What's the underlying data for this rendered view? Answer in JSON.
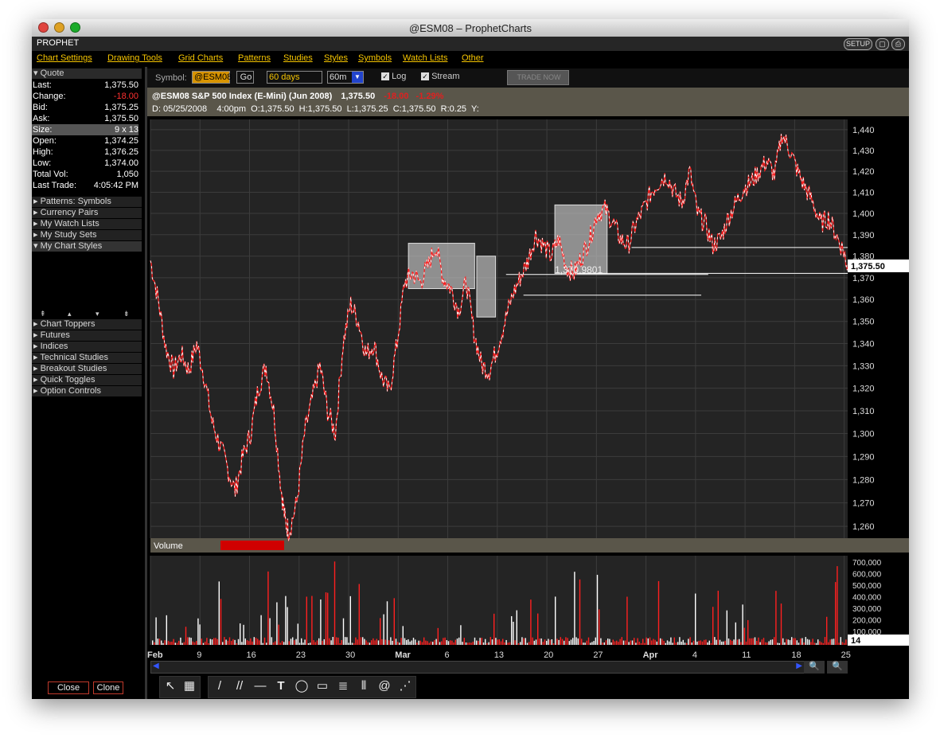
{
  "window": {
    "title": "@ESM08 – ProphetCharts"
  },
  "brand": {
    "name": "PROPHET",
    "setup": "SETUP"
  },
  "menu": [
    "Chart Settings",
    "Drawing Tools",
    "Grid Charts",
    "Patterns",
    "Studies",
    "Styles",
    "Symbols",
    "Watch Lists",
    "Other"
  ],
  "quote": {
    "header": "Quote",
    "rows": [
      {
        "label": "Last:",
        "value": "1,375.50"
      },
      {
        "label": "Change:",
        "value": "-18.00"
      },
      {
        "label": "Bid:",
        "value": "1,375.25"
      },
      {
        "label": "Ask:",
        "value": "1,375.50"
      },
      {
        "label": "Size:",
        "value": "9 x 13"
      },
      {
        "label": "Open:",
        "value": "1,374.25"
      },
      {
        "label": "High:",
        "value": "1,376.25"
      },
      {
        "label": "Low:",
        "value": "1,374.00"
      },
      {
        "label": "Total Vol:",
        "value": "1,050"
      },
      {
        "label": "Last Trade:",
        "value": "4:05:42 PM"
      }
    ]
  },
  "sidebar_sections_top": [
    "Patterns: Symbols",
    "Currency Pairs",
    "My Watch Lists",
    "My Study Sets",
    "My Chart Styles"
  ],
  "sidebar_sections_bottom": [
    "Chart Toppers",
    "Futures",
    "Indices",
    "Technical Studies",
    "Breakout Studies",
    "Quick Toggles",
    "Option Controls"
  ],
  "sidebar_buttons": {
    "close": "Close",
    "clone": "Clone"
  },
  "toolbar": {
    "symbol_label": "Symbol:",
    "symbol_value": "@ESM08",
    "go": "Go",
    "range": "60 days",
    "interval": "60m",
    "log_label": "Log",
    "stream_label": "Stream",
    "trade_now": "TRADE NOW"
  },
  "info": {
    "line1_symbol": "@ESM08 S&P 500 Index (E-Mini) (Jun 2008)",
    "line1_price": "1,375.50",
    "line1_change": "-18.00",
    "line1_pct": "-1.29%",
    "line2": "D: 05/25/2008    4:00pm  O:1,375.50  H:1,375.50  L:1,375.25  C:1,375.50  R:0.25  Y:"
  },
  "chart_data": {
    "type": "candlestick-line",
    "price_axis": {
      "ticks": [
        "1,440",
        "1,430",
        "1,420",
        "1,410",
        "1,400",
        "1,390",
        "1,380",
        "1,370",
        "1,360",
        "1,350",
        "1,340",
        "1,330",
        "1,320",
        "1,310",
        "1,300",
        "1,290",
        "1,280",
        "1,270",
        "1,260"
      ],
      "ylim": [
        1255,
        1445
      ],
      "scale": "log"
    },
    "last_price_label": "1,375.50",
    "annotation": "1,370.9801",
    "volume_label": "Volume",
    "volume_axis": {
      "ticks": [
        "700,000",
        "600,000",
        "500,000",
        "400,000",
        "300,000",
        "200,000",
        "100,000"
      ],
      "current": "14"
    },
    "x_ticks": [
      {
        "label": "Feb"
      },
      {
        "label": "9"
      },
      {
        "label": "16"
      },
      {
        "label": "23"
      },
      {
        "label": "30"
      },
      {
        "label": "Mar"
      },
      {
        "label": "6"
      },
      {
        "label": "13"
      },
      {
        "label": "20"
      },
      {
        "label": "27"
      },
      {
        "label": "Apr"
      },
      {
        "label": "4"
      },
      {
        "label": "11"
      },
      {
        "label": "18"
      },
      {
        "label": "25"
      }
    ],
    "price_path": [
      [
        0,
        1378
      ],
      [
        0.01,
        1360
      ],
      [
        0.02,
        1338
      ],
      [
        0.03,
        1328
      ],
      [
        0.04,
        1335
      ],
      [
        0.05,
        1328
      ],
      [
        0.06,
        1340
      ],
      [
        0.07,
        1325
      ],
      [
        0.08,
        1305
      ],
      [
        0.09,
        1295
      ],
      [
        0.1,
        1285
      ],
      [
        0.11,
        1275
      ],
      [
        0.12,
        1290
      ],
      [
        0.13,
        1300
      ],
      [
        0.14,
        1320
      ],
      [
        0.15,
        1330
      ],
      [
        0.16,
        1310
      ],
      [
        0.17,
        1275
      ],
      [
        0.175,
        1262
      ],
      [
        0.18,
        1258
      ],
      [
        0.19,
        1270
      ],
      [
        0.2,
        1300
      ],
      [
        0.21,
        1315
      ],
      [
        0.22,
        1330
      ],
      [
        0.23,
        1310
      ],
      [
        0.24,
        1300
      ],
      [
        0.25,
        1340
      ],
      [
        0.26,
        1358
      ],
      [
        0.27,
        1350
      ],
      [
        0.28,
        1335
      ],
      [
        0.29,
        1340
      ],
      [
        0.3,
        1325
      ],
      [
        0.31,
        1318
      ],
      [
        0.32,
        1340
      ],
      [
        0.33,
        1368
      ],
      [
        0.34,
        1372
      ],
      [
        0.35,
        1368
      ],
      [
        0.36,
        1375
      ],
      [
        0.37,
        1385
      ],
      [
        0.38,
        1370
      ],
      [
        0.39,
        1365
      ],
      [
        0.4,
        1355
      ],
      [
        0.41,
        1368
      ],
      [
        0.42,
        1345
      ],
      [
        0.43,
        1330
      ],
      [
        0.44,
        1328
      ],
      [
        0.45,
        1338
      ],
      [
        0.46,
        1350
      ],
      [
        0.47,
        1362
      ],
      [
        0.48,
        1370
      ],
      [
        0.49,
        1378
      ],
      [
        0.5,
        1390
      ],
      [
        0.51,
        1385
      ],
      [
        0.52,
        1380
      ],
      [
        0.53,
        1388
      ],
      [
        0.54,
        1375
      ],
      [
        0.55,
        1372
      ],
      [
        0.56,
        1380
      ],
      [
        0.57,
        1388
      ],
      [
        0.58,
        1400
      ],
      [
        0.59,
        1402
      ],
      [
        0.6,
        1396
      ],
      [
        0.61,
        1388
      ],
      [
        0.62,
        1385
      ],
      [
        0.63,
        1395
      ],
      [
        0.64,
        1402
      ],
      [
        0.65,
        1410
      ],
      [
        0.66,
        1415
      ],
      [
        0.67,
        1418
      ],
      [
        0.68,
        1410
      ],
      [
        0.69,
        1405
      ],
      [
        0.7,
        1420
      ],
      [
        0.71,
        1400
      ],
      [
        0.72,
        1395
      ],
      [
        0.73,
        1385
      ],
      [
        0.74,
        1388
      ],
      [
        0.75,
        1398
      ],
      [
        0.76,
        1405
      ],
      [
        0.77,
        1412
      ],
      [
        0.78,
        1415
      ],
      [
        0.79,
        1420
      ],
      [
        0.8,
        1425
      ],
      [
        0.81,
        1418
      ],
      [
        0.82,
        1438
      ],
      [
        0.83,
        1430
      ],
      [
        0.84,
        1420
      ],
      [
        0.85,
        1412
      ],
      [
        0.86,
        1405
      ],
      [
        0.87,
        1395
      ],
      [
        0.88,
        1398
      ],
      [
        0.89,
        1390
      ],
      [
        0.9,
        1382
      ],
      [
        0.905,
        1375
      ]
    ],
    "volume_bars_note": "hourly volume bars, red/white"
  }
}
